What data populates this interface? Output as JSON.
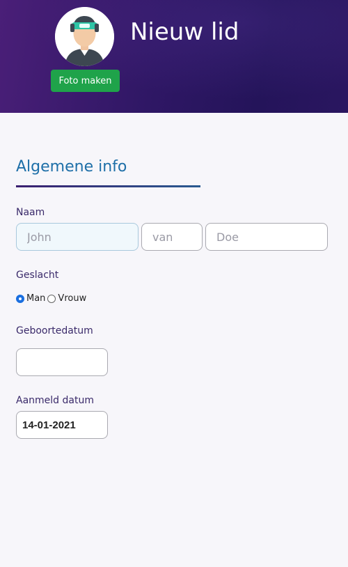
{
  "header": {
    "title": "Nieuw lid",
    "photo_button_label": "Foto maken"
  },
  "section": {
    "title": "Algemene info"
  },
  "form": {
    "name_label": "Naam",
    "first_name_placeholder": "John",
    "middle_name_placeholder": "van",
    "last_name_placeholder": "Doe",
    "gender_label": "Geslacht",
    "gender_options": [
      {
        "label": "Man",
        "selected": true
      },
      {
        "label": "Vrouw",
        "selected": false
      }
    ],
    "birthdate_label": "Geboortedatum",
    "birthdate_value": "",
    "signup_label": "Aanmeld datum",
    "signup_value": "14-01-2021"
  },
  "colors": {
    "header_bg": "#2f1765",
    "accent_green": "#1fa34a",
    "section_title": "#1e6fa8"
  },
  "icons": {
    "avatar": "user-avatar-icon"
  }
}
